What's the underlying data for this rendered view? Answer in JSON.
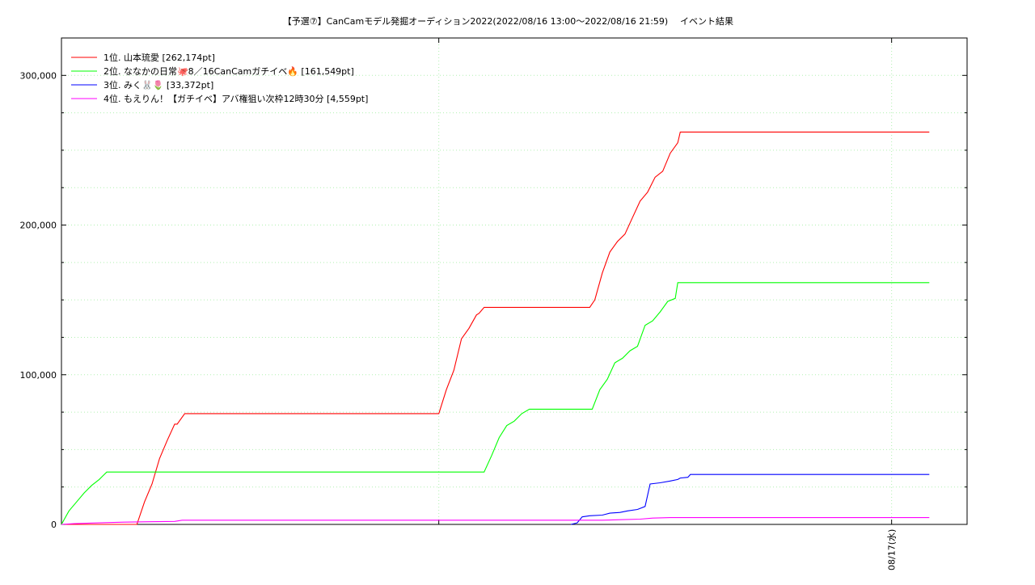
{
  "chart_data": {
    "type": "line",
    "title": "【予選⑦】CanCamモデル発掘オーディション2022(2022/08/16 13:00～2022/08/16 21:59)",
    "subtitle": "イベント結果",
    "xlabel": "",
    "ylabel": "",
    "ylim": [
      0,
      325000
    ],
    "xlim": [
      "2022/08/16 13:00",
      "2022/08/17 01:00"
    ],
    "y_ticks": [
      "0",
      "100,000",
      "200,000",
      "300,000"
    ],
    "x_ticks": [
      "08/17(水)"
    ],
    "grid": true,
    "legend_position": "top-left",
    "series": [
      {
        "name": "1位. 山本琉愛 [262,174pt]",
        "color": "#ff0000",
        "points": [
          [
            "2022/08/16 13:03",
            0
          ],
          [
            "2022/08/16 14:00",
            0
          ],
          [
            "2022/08/16 14:06",
            15000
          ],
          [
            "2022/08/16 14:12",
            27000
          ],
          [
            "2022/08/16 14:18",
            44000
          ],
          [
            "2022/08/16 14:24",
            56000
          ],
          [
            "2022/08/16 14:30",
            67000
          ],
          [
            "2022/08/16 14:32",
            67000
          ],
          [
            "2022/08/16 14:38",
            74000
          ],
          [
            "2022/08/16 18:00",
            74000
          ],
          [
            "2022/08/16 18:06",
            90000
          ],
          [
            "2022/08/16 18:12",
            103000
          ],
          [
            "2022/08/16 18:18",
            124000
          ],
          [
            "2022/08/16 18:24",
            131000
          ],
          [
            "2022/08/16 18:30",
            140000
          ],
          [
            "2022/08/16 18:32",
            141000
          ],
          [
            "2022/08/16 18:36",
            145000
          ],
          [
            "2022/08/16 20:00",
            145000
          ],
          [
            "2022/08/16 20:04",
            150000
          ],
          [
            "2022/08/16 20:10",
            168000
          ],
          [
            "2022/08/16 20:16",
            182000
          ],
          [
            "2022/08/16 20:22",
            189000
          ],
          [
            "2022/08/16 20:28",
            194000
          ],
          [
            "2022/08/16 20:34",
            205000
          ],
          [
            "2022/08/16 20:40",
            216000
          ],
          [
            "2022/08/16 20:46",
            222000
          ],
          [
            "2022/08/16 20:52",
            232000
          ],
          [
            "2022/08/16 20:58",
            236000
          ],
          [
            "2022/08/16 21:04",
            248000
          ],
          [
            "2022/08/16 21:10",
            255000
          ],
          [
            "2022/08/16 21:12",
            262174
          ],
          [
            "2022/08/17 00:30",
            262174
          ]
        ]
      },
      {
        "name": "2位. ななかの日常🐙8／16CanCamガチイベ🔥 [161,549pt]",
        "color": "#00ff00",
        "points": [
          [
            "2022/08/16 13:00",
            0
          ],
          [
            "2022/08/16 13:06",
            9000
          ],
          [
            "2022/08/16 13:12",
            15000
          ],
          [
            "2022/08/16 13:18",
            21000
          ],
          [
            "2022/08/16 13:24",
            26000
          ],
          [
            "2022/08/16 13:30",
            30000
          ],
          [
            "2022/08/16 13:36",
            35000
          ],
          [
            "2022/08/16 18:36",
            35000
          ],
          [
            "2022/08/16 18:42",
            46000
          ],
          [
            "2022/08/16 18:48",
            58000
          ],
          [
            "2022/08/16 18:54",
            66000
          ],
          [
            "2022/08/16 19:00",
            69000
          ],
          [
            "2022/08/16 19:06",
            74000
          ],
          [
            "2022/08/16 19:12",
            77000
          ],
          [
            "2022/08/16 20:02",
            77000
          ],
          [
            "2022/08/16 20:08",
            90000
          ],
          [
            "2022/08/16 20:14",
            97000
          ],
          [
            "2022/08/16 20:20",
            108000
          ],
          [
            "2022/08/16 20:26",
            111000
          ],
          [
            "2022/08/16 20:32",
            116000
          ],
          [
            "2022/08/16 20:38",
            119000
          ],
          [
            "2022/08/16 20:44",
            133000
          ],
          [
            "2022/08/16 20:50",
            136000
          ],
          [
            "2022/08/16 20:56",
            142000
          ],
          [
            "2022/08/16 21:02",
            149000
          ],
          [
            "2022/08/16 21:08",
            151000
          ],
          [
            "2022/08/16 21:10",
            161549
          ],
          [
            "2022/08/17 00:30",
            161549
          ]
        ]
      },
      {
        "name": "3位. みく🐰🌷 [33,372pt]",
        "color": "#0000ff",
        "points": [
          [
            "2022/08/16 19:45",
            0
          ],
          [
            "2022/08/16 19:50",
            1000
          ],
          [
            "2022/08/16 19:54",
            5000
          ],
          [
            "2022/08/16 20:00",
            5800
          ],
          [
            "2022/08/16 20:10",
            6200
          ],
          [
            "2022/08/16 20:16",
            7500
          ],
          [
            "2022/08/16 20:24",
            8000
          ],
          [
            "2022/08/16 20:30",
            9000
          ],
          [
            "2022/08/16 20:38",
            10000
          ],
          [
            "2022/08/16 20:44",
            12000
          ],
          [
            "2022/08/16 20:48",
            27000
          ],
          [
            "2022/08/16 20:56",
            27800
          ],
          [
            "2022/08/16 21:04",
            29000
          ],
          [
            "2022/08/16 21:10",
            30000
          ],
          [
            "2022/08/16 21:12",
            31000
          ],
          [
            "2022/08/16 21:18",
            31500
          ],
          [
            "2022/08/16 21:20",
            33372
          ],
          [
            "2022/08/17 00:30",
            33372
          ]
        ]
      },
      {
        "name": "4位. もえりん！【ガチイベ】アバ権狙い次枠12時30分 [4,559pt]",
        "color": "#ff00ff",
        "points": [
          [
            "2022/08/16 13:00",
            0
          ],
          [
            "2022/08/16 13:10",
            500
          ],
          [
            "2022/08/16 13:30",
            1000
          ],
          [
            "2022/08/16 13:50",
            1500
          ],
          [
            "2022/08/16 14:10",
            1800
          ],
          [
            "2022/08/16 14:30",
            2000
          ],
          [
            "2022/08/16 14:36",
            2800
          ],
          [
            "2022/08/16 20:10",
            2800
          ],
          [
            "2022/08/16 20:40",
            3500
          ],
          [
            "2022/08/16 20:50",
            4200
          ],
          [
            "2022/08/16 21:04",
            4559
          ],
          [
            "2022/08/17 00:30",
            4559
          ]
        ]
      }
    ]
  }
}
